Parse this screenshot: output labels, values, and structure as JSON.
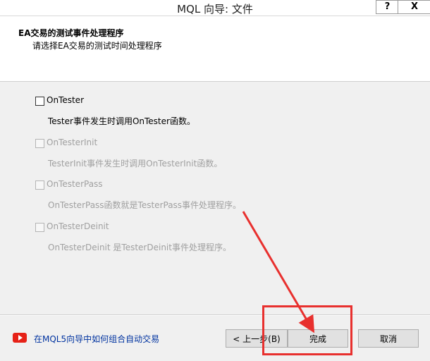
{
  "window": {
    "title": "MQL 向导: 文件",
    "help_glyph": "?",
    "close_glyph": "X"
  },
  "header": {
    "title": "EA交易的测试事件处理程序",
    "subtitle": "请选择EA交易的测试时间处理程序"
  },
  "options": [
    {
      "label": "OnTester",
      "description": "Tester事件发生时调用OnTester函数。",
      "checked": false,
      "enabled": true
    },
    {
      "label": "OnTesterInit",
      "description": "TesterInit事件发生时调用OnTesterInit函数。",
      "checked": false,
      "enabled": false
    },
    {
      "label": "OnTesterPass",
      "description": "OnTesterPass函数就是TesterPass事件处理程序。",
      "checked": false,
      "enabled": false
    },
    {
      "label": "OnTesterDeinit",
      "description": "OnTesterDeinit 是TesterDeinit事件处理程序。",
      "checked": false,
      "enabled": false
    }
  ],
  "footer": {
    "help_link": "在MQL5向导中如何组合自动交易",
    "back_label": "< 上一步(B)",
    "finish_label": "完成",
    "cancel_label": "取消",
    "help_icon": "youtube-icon"
  },
  "annotation": {
    "color": "#e8302e"
  }
}
